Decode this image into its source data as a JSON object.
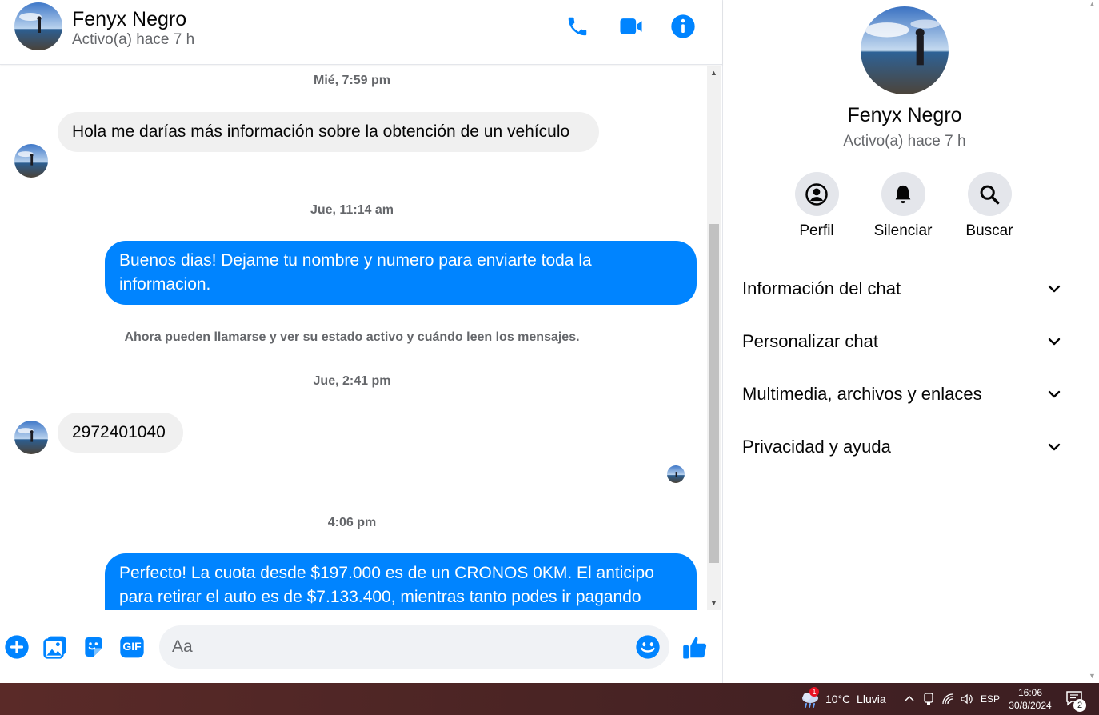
{
  "contact": {
    "name": "Fenyx Negro",
    "status": "Activo(a) hace 7 h"
  },
  "header": {
    "icons": [
      "phone-icon",
      "video-camera-icon",
      "info-icon"
    ]
  },
  "messages": [
    {
      "kind": "timestamp",
      "text": "Mié, 7:59 pm"
    },
    {
      "kind": "incoming",
      "text": "Hola me darías más información sobre la obtención de un vehículo"
    },
    {
      "kind": "timestamp",
      "text": "Jue, 11:14 am"
    },
    {
      "kind": "outgoing",
      "text": "Buenos dias! Dejame tu nombre y  numero para enviarte toda la informacion."
    },
    {
      "kind": "notice",
      "text": "Ahora pueden llamarse y ver su estado activo y cuándo leen los mensajes."
    },
    {
      "kind": "timestamp",
      "text": "Jue, 2:41 pm"
    },
    {
      "kind": "incoming",
      "text": "2972401040"
    },
    {
      "kind": "timestamp",
      "text": "4:06 pm"
    },
    {
      "kind": "outgoing",
      "text": "Perfecto! La cuota desde $197.000 es de un CRONOS 0KM. El anticipo para retirar el auto es de $7.133.400, mientras tanto podes ir pagando"
    }
  ],
  "composer": {
    "placeholder": "Aa",
    "tools": [
      "plus-icon",
      "photo-icon",
      "sticker-icon",
      "gif-icon"
    ],
    "gif_label": "GIF"
  },
  "panel": {
    "actions": [
      {
        "label": "Perfil",
        "icon": "profile-icon"
      },
      {
        "label": "Silenciar",
        "icon": "bell-icon"
      },
      {
        "label": "Buscar",
        "icon": "search-icon"
      }
    ],
    "sections": [
      "Información del chat",
      "Personalizar chat",
      "Multimedia, archivos y enlaces",
      "Privacidad y ayuda"
    ]
  },
  "taskbar": {
    "weather_badge": "1",
    "weather": "10°C  Lluvia",
    "language": "ESP",
    "time": "16:06",
    "date": "30/8/2024",
    "notifications": "2"
  },
  "colors": {
    "accent": "#0084ff",
    "incoming_bubble": "#f0f0f0",
    "muted_text": "#65676b"
  }
}
